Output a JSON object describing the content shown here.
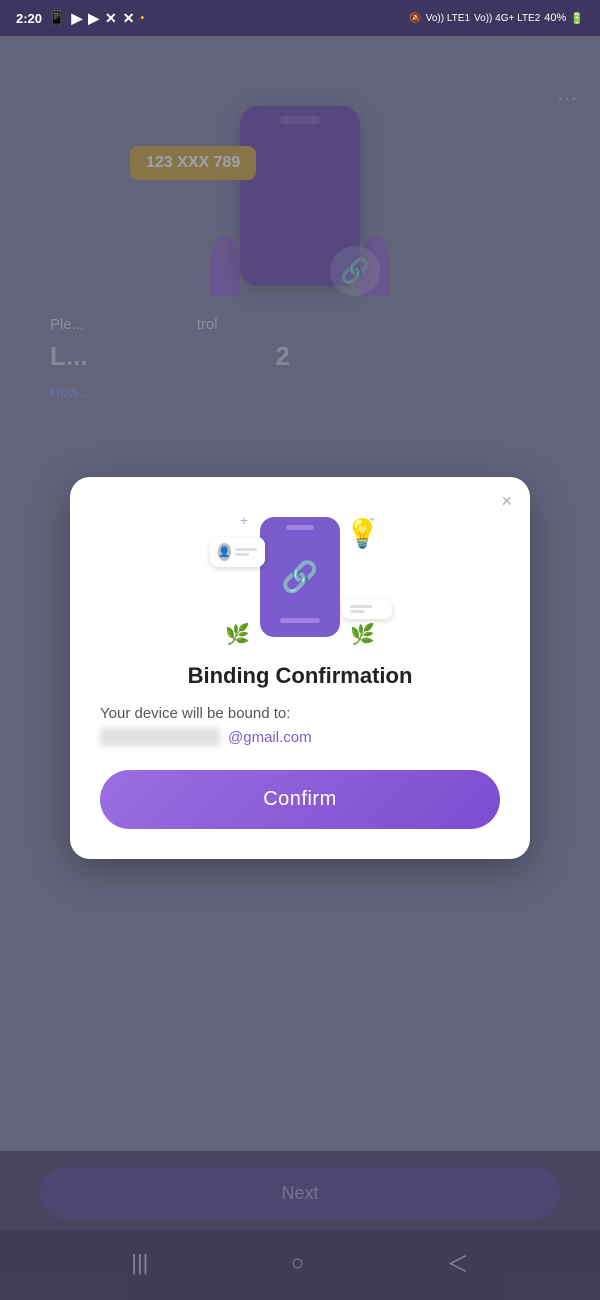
{
  "statusBar": {
    "time": "2:20",
    "battery": "40%"
  },
  "threeDots": "⋯",
  "backgroundPhone": {
    "numberTag": "123 XXX 789"
  },
  "backgroundText": {
    "line1": "Ple...",
    "bigText": "L...",
    "link": "How...",
    "suffix": "trol",
    "number": "2"
  },
  "modal": {
    "closeIcon": "×",
    "title": "Binding Confirmation",
    "bodyText": "Your device will be bound to:",
    "emailSuffix": "@gmail.com",
    "confirmLabel": "Confirm"
  },
  "bottomNav": {
    "nextLabel": "Next",
    "navIcons": [
      "|||",
      "○",
      "<"
    ]
  }
}
